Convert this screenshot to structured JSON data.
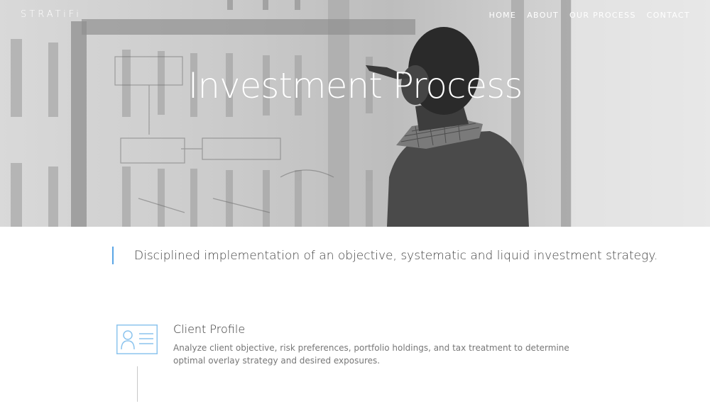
{
  "header": {
    "logo": "STRATiFi",
    "nav": [
      {
        "label": "HOME"
      },
      {
        "label": "ABOUT"
      },
      {
        "label": "OUR PROCESS"
      },
      {
        "label": "CONTACT"
      }
    ]
  },
  "hero": {
    "title": "Investment Process"
  },
  "intro": {
    "tagline": "Disciplined implementation of an objective, systematic and liquid investment strategy."
  },
  "steps": [
    {
      "icon": "id-card-icon",
      "title": "Client Profile",
      "description": "Analyze client objective, risk preferences, portfolio holdings, and tax treatment to determine optimal overlay strategy and desired exposures."
    }
  ],
  "colors": {
    "accent": "#5aa5e6",
    "icon": "#8cc4ee"
  }
}
